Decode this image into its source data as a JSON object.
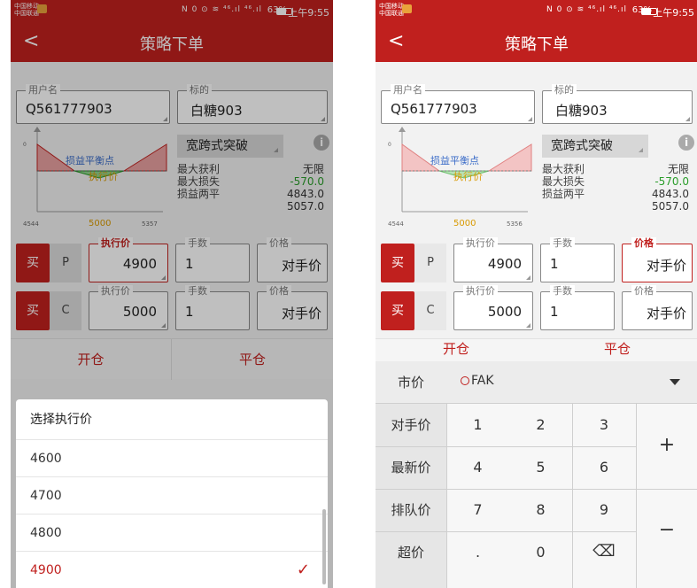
{
  "status": {
    "operator1": "中国移动",
    "operator2": "中国联通",
    "signal": "N 0 ⊙ ≋ ⁴⁶.ıl ⁴⁶.ıl",
    "battery": "63%",
    "time": "上午9:55"
  },
  "header": {
    "back": "<",
    "title": "策略下单"
  },
  "form": {
    "user_label": "用户名",
    "user_value": "Q561777903",
    "target_label": "标的",
    "target_value": "白糖903"
  },
  "strategy": {
    "name": "宽跨式突破",
    "info_icon": "i",
    "rows": [
      {
        "k": "最大获利",
        "v": "无限"
      },
      {
        "k": "最大损失",
        "v": "-570.0"
      },
      {
        "k": "损益两平",
        "v": "4843.0"
      },
      {
        "k": "",
        "v": "5057.0"
      }
    ]
  },
  "chart_left": {
    "ticks": [
      "4544",
      "5000",
      "5357"
    ],
    "zero": "0",
    "breakeven": "损益平衡点",
    "strike": "执行价"
  },
  "chart_right": {
    "ticks": [
      "4544",
      "5000",
      "5356"
    ],
    "zero": "0",
    "breakeven": "损益平衡点",
    "strike": "执行价"
  },
  "legs": [
    {
      "buy": "买",
      "type": "P",
      "strike_label": "执行价",
      "strike": "4900",
      "qty_label": "手数",
      "qty": "1",
      "price_label": "价格",
      "price": "对手价"
    },
    {
      "buy": "买",
      "type": "C",
      "strike_label": "执行价",
      "strike": "5000",
      "qty_label": "手数",
      "qty": "1",
      "price_label": "价格",
      "price": "对手价"
    }
  ],
  "tabs": {
    "open": "开仓",
    "close": "平仓"
  },
  "picker": {
    "header": "选择执行价",
    "options": [
      "4600",
      "4700",
      "4800",
      "4900"
    ],
    "selected": "4900"
  },
  "keyboard": {
    "labels": [
      "市价",
      "对手价",
      "最新价",
      "排队价",
      "超价"
    ],
    "fak": "FAK",
    "digits": [
      "1",
      "2",
      "3",
      "4",
      "5",
      "6",
      "7",
      "8",
      "9",
      ".",
      "0"
    ],
    "plus": "+",
    "minus": "−",
    "backspace": "⌫"
  },
  "colors": {
    "accent": "#c0201e",
    "positive": "#2a9d2a",
    "gold": "#d99a00",
    "blue": "#3b6cc8"
  }
}
